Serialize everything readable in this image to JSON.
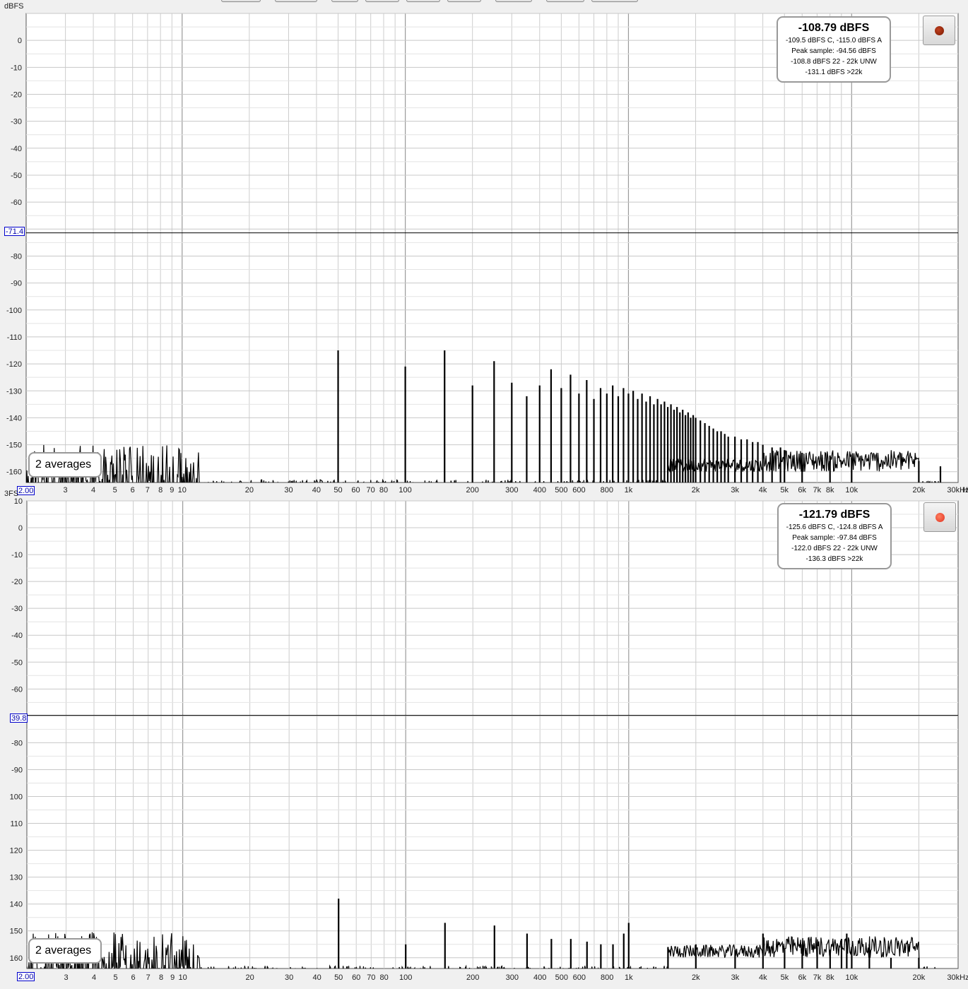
{
  "top_panel": {
    "y_unit": "dBFS",
    "x_unit": "Hz",
    "cursor_value": "-71.4",
    "x_start_label": "2.00",
    "info": {
      "main": "-108.79 dBFS",
      "line1": "-109.5 dBFS C, -115.0 dBFS A",
      "line2": "Peak sample: -94.56 dBFS",
      "line3": "-108.8 dBFS 22 - 22k UNW",
      "line4": "-131.1 dBFS >22k"
    },
    "averages": "2 averages",
    "record_dot_color": "#7a1a00"
  },
  "bottom_panel": {
    "y_unit": "3FS",
    "cursor_value": "39.8",
    "x_start_label": "2.00",
    "info": {
      "main": "-121.79 dBFS",
      "line1": "-125.6 dBFS C, -124.8 dBFS A",
      "line2": "Peak sample: -97.84 dBFS",
      "line3": "-122.0 dBFS 22 - 22k UNW",
      "line4": "-136.3 dBFS >22k"
    },
    "averages": "2 averages",
    "record_dot_color": "#e03020"
  },
  "chart_data": [
    {
      "type": "line",
      "xscale": "log",
      "xlim": [
        2,
        30000
      ],
      "ylim": [
        -164,
        10
      ],
      "ylabel": "dBFS",
      "xlabel": "Hz",
      "y_ticks": [
        "0",
        "-10",
        "-20",
        "-30",
        "-40",
        "-50",
        "-60",
        "-80",
        "-90",
        "-100",
        "-110",
        "-120",
        "-130",
        "-140",
        "-150",
        "-160"
      ],
      "x_ticks": [
        "3",
        "4",
        "5",
        "6",
        "7",
        "8",
        "9",
        "10",
        "20",
        "30",
        "40",
        "50",
        "60",
        "70",
        "80",
        "100",
        "200",
        "300",
        "400",
        "500",
        "600",
        "800",
        "1k",
        "2k",
        "3k",
        "4k",
        "5k",
        "6k",
        "7k",
        "8k",
        "10k",
        "20k",
        "30kHz"
      ],
      "grid": true,
      "cursor_y": -71.4,
      "peaks": {
        "x": [
          50,
          100,
          150,
          200,
          250,
          300,
          350,
          400,
          450,
          500,
          550,
          600,
          650,
          700,
          750,
          800,
          850,
          900,
          950,
          1000,
          1050,
          1100,
          1150,
          1200,
          1250,
          1300,
          1350,
          1400,
          1450,
          1500,
          1550,
          1600,
          1650,
          1700,
          1750,
          1800,
          1850,
          1900,
          1950,
          2000,
          2100,
          2200,
          2300,
          2400,
          2500,
          2600,
          2700,
          2800,
          3000,
          3200,
          3400,
          3600,
          3800,
          4000,
          4400,
          4800,
          5000,
          6000,
          8000,
          10000,
          20000,
          25000
        ],
        "y": [
          -115,
          -121,
          -115,
          -128,
          -119,
          -127,
          -132,
          -128,
          -122,
          -129,
          -124,
          -131,
          -126,
          -133,
          -129,
          -131,
          -128,
          -132,
          -129,
          -131,
          -130,
          -133,
          -131,
          -134,
          -132,
          -135,
          -133,
          -135,
          -134,
          -136,
          -135,
          -137,
          -136,
          -138,
          -137,
          -139,
          -138,
          -140,
          -139,
          -140,
          -141,
          -142,
          -143,
          -144,
          -145,
          -145,
          -146,
          -147,
          -147,
          -148,
          -148,
          -149,
          -149,
          -150,
          -151,
          -151,
          -152,
          -153,
          -154,
          -155,
          -156,
          -158
        ]
      }
    },
    {
      "type": "line",
      "xscale": "log",
      "xlim": [
        2,
        30000
      ],
      "ylim": [
        -164,
        10
      ],
      "ylabel": "3FS",
      "xlabel": "",
      "y_ticks": [
        "10",
        "0",
        "-10",
        "-20",
        "-30",
        "-40",
        "-50",
        "-60",
        "-80",
        "-90",
        "100",
        "110",
        "120",
        "130",
        "140",
        "150",
        "160"
      ],
      "x_ticks": [
        "3",
        "4",
        "5",
        "6",
        "7",
        "8",
        "9",
        "10",
        "20",
        "30",
        "40",
        "50",
        "60",
        "70",
        "80",
        "100",
        "200",
        "300",
        "400",
        "500",
        "600",
        "800",
        "1k",
        "2k",
        "3k",
        "4k",
        "5k",
        "6k",
        "7k",
        "8k",
        "10k",
        "20k",
        "30kHz"
      ],
      "grid": true,
      "cursor_y": -69.8,
      "peaks": {
        "x": [
          50,
          100,
          150,
          250,
          350,
          450,
          550,
          650,
          750,
          850,
          950,
          1000,
          1500,
          2000,
          3000,
          4000,
          5000,
          6000,
          7000,
          8000,
          9000,
          9500,
          10000,
          12000,
          15000,
          20000
        ],
        "y": [
          -138,
          -155,
          -147,
          -148,
          -151,
          -153,
          -153,
          -154,
          -155,
          -155,
          -151,
          -147,
          -156,
          -155,
          -157,
          -151,
          -157,
          -155,
          -156,
          -157,
          -153,
          -151,
          -156,
          -155,
          -160,
          -160
        ]
      }
    }
  ]
}
